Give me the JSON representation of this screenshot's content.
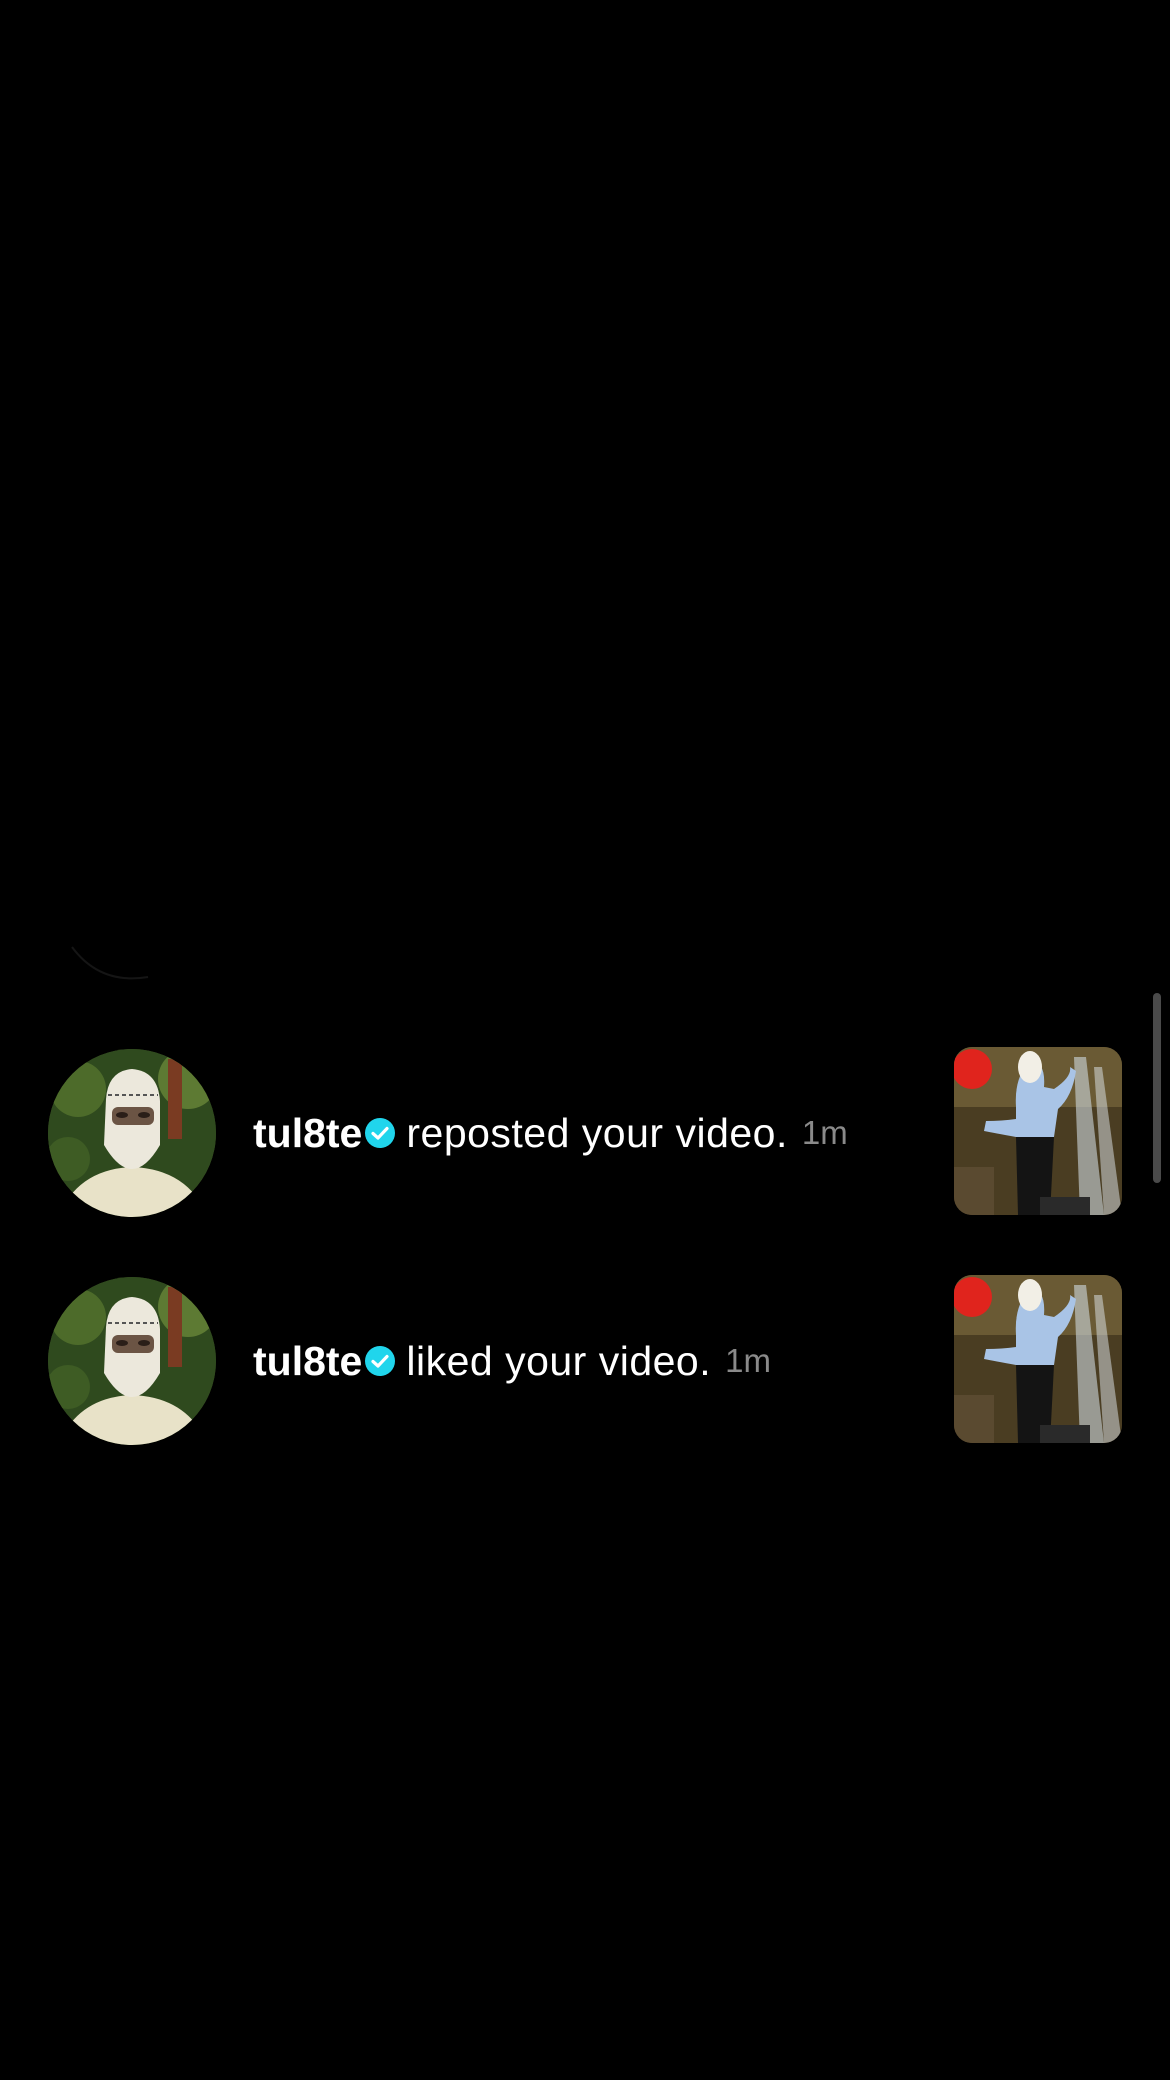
{
  "notifications": [
    {
      "username": "tul8te",
      "action": "reposted your video.",
      "time": "1m",
      "verified": true
    },
    {
      "username": "tul8te",
      "action": "liked your video.",
      "time": "1m",
      "verified": true
    }
  ],
  "icons": {
    "verified": "verified-badge-icon",
    "avatar": "avatar",
    "thumbnail": "video-thumbnail"
  },
  "colors": {
    "background": "#000000",
    "text": "#ffffff",
    "timestamp": "#8a8a8a",
    "verified": "#20d5ec"
  }
}
